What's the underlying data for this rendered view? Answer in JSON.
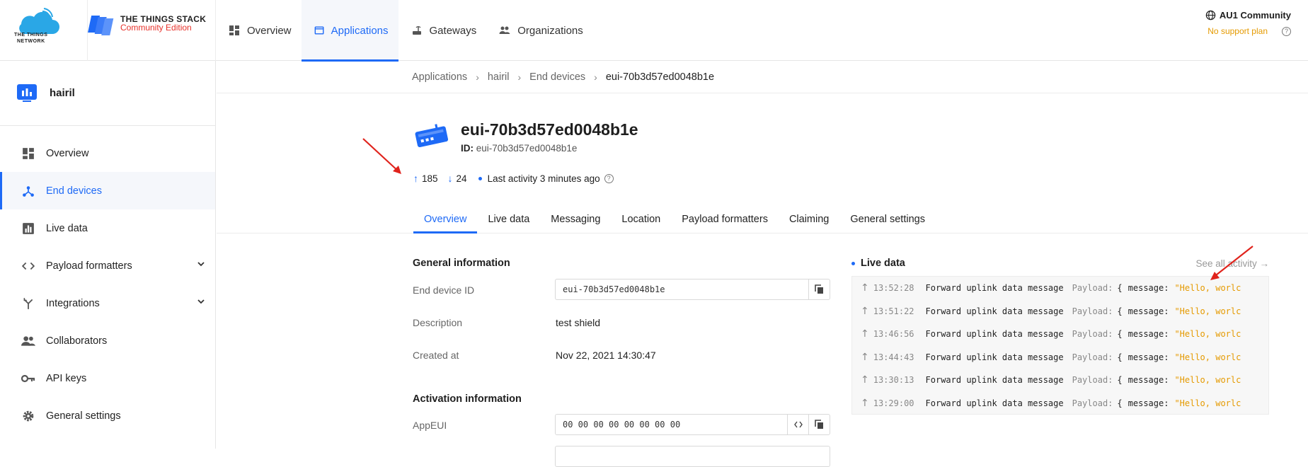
{
  "topbar": {
    "brand_line1": "THE THINGS",
    "brand_line2": "NETWORK",
    "stack_title": "THE THINGS STACK",
    "stack_edition": "Community Edition",
    "nav": [
      {
        "label": "Overview",
        "icon": "dashboard-icon"
      },
      {
        "label": "Applications",
        "icon": "application-icon",
        "active": true
      },
      {
        "label": "Gateways",
        "icon": "gateway-icon"
      },
      {
        "label": "Organizations",
        "icon": "organization-icon"
      }
    ],
    "cluster": "AU1 Community",
    "support": "No support plan"
  },
  "sidebar": {
    "app_name": "hairil",
    "items": [
      {
        "label": "Overview"
      },
      {
        "label": "End devices"
      },
      {
        "label": "Live data"
      },
      {
        "label": "Payload formatters"
      },
      {
        "label": "Integrations"
      },
      {
        "label": "Collaborators"
      },
      {
        "label": "API keys"
      },
      {
        "label": "General settings"
      }
    ]
  },
  "breadcrumb": [
    "Applications",
    "hairil",
    "End devices",
    "eui-70b3d57ed0048b1e"
  ],
  "device": {
    "title": "eui-70b3d57ed0048b1e",
    "id_label": "ID:",
    "id_value": "eui-70b3d57ed0048b1e",
    "uplink": "185",
    "downlink": "24",
    "activity": "Last activity 3 minutes ago"
  },
  "tabs": [
    "Overview",
    "Live data",
    "Messaging",
    "Location",
    "Payload formatters",
    "Claiming",
    "General settings"
  ],
  "general": {
    "title": "General information",
    "end_device_id_label": "End device ID",
    "end_device_id": "eui-70b3d57ed0048b1e",
    "description_label": "Description",
    "description": "test shield",
    "created_label": "Created at",
    "created": "Nov 22, 2021 14:30:47"
  },
  "activation": {
    "title": "Activation information",
    "appeui_label": "AppEUI",
    "appeui": "00 00 00 00 00 00 00 00"
  },
  "live": {
    "title": "Live data",
    "see_all": "See all activity →",
    "rows": [
      {
        "time": "13:52:28",
        "type": "Forward uplink data message",
        "payload": "Payload:",
        "brace": "{",
        "key": "message:",
        "value": "\"Hello, worlc"
      },
      {
        "time": "13:51:22",
        "type": "Forward uplink data message",
        "payload": "Payload:",
        "brace": "{",
        "key": "message:",
        "value": "\"Hello, worlc"
      },
      {
        "time": "13:46:56",
        "type": "Forward uplink data message",
        "payload": "Payload:",
        "brace": "{",
        "key": "message:",
        "value": "\"Hello, worlc"
      },
      {
        "time": "13:44:43",
        "type": "Forward uplink data message",
        "payload": "Payload:",
        "brace": "{",
        "key": "message:",
        "value": "\"Hello, worlc"
      },
      {
        "time": "13:30:13",
        "type": "Forward uplink data message",
        "payload": "Payload:",
        "brace": "{",
        "key": "message:",
        "value": "\"Hello, worlc"
      },
      {
        "time": "13:29:00",
        "type": "Forward uplink data message",
        "payload": "Payload:",
        "brace": "{",
        "key": "message:",
        "value": "\"Hello, worlc"
      }
    ]
  },
  "colors": {
    "accent": "#1e6af6",
    "brand_red": "#e8322b",
    "warning": "#e59a00",
    "annotation": "#e0231c"
  }
}
